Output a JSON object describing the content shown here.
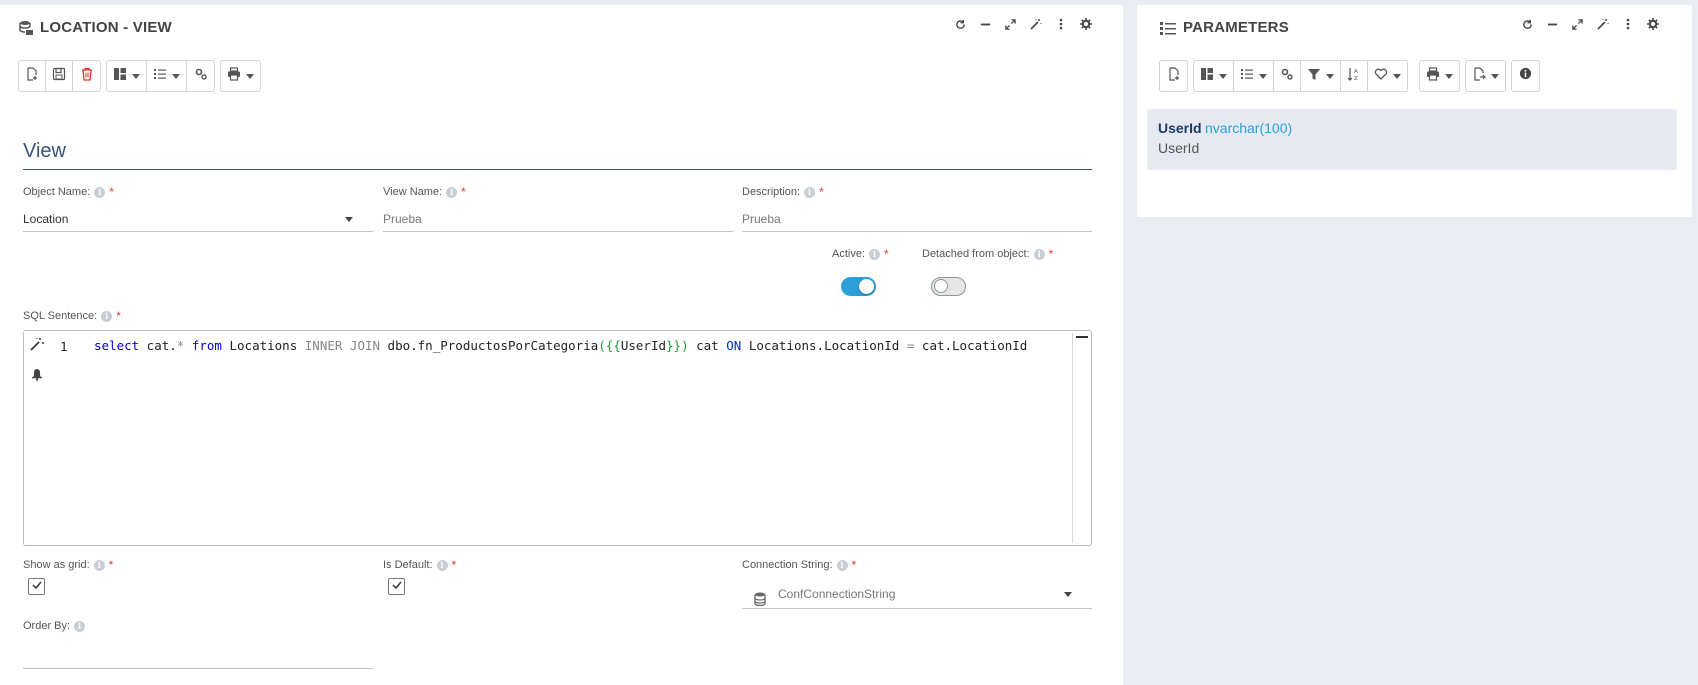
{
  "left_panel": {
    "title": "LOCATION - VIEW",
    "section_title": "View",
    "fields": {
      "object_name": {
        "label": "Object Name:",
        "value": "Location"
      },
      "view_name": {
        "label": "View Name:",
        "value": "Prueba"
      },
      "description": {
        "label": "Description:",
        "value": "Prueba"
      },
      "active": {
        "label": "Active:",
        "on": true
      },
      "detached": {
        "label": "Detached from object:",
        "on": false
      },
      "sql": {
        "label": "SQL Sentence:",
        "line_number": "1",
        "tokens": {
          "select": "select",
          "cat_star": " cat.",
          "star": "*",
          "from": " from",
          "locations": " Locations ",
          "inner_join": "INNER JOIN",
          "fn": " dbo.fn_ProductosPorCategoria",
          "open": "({{",
          "param": "UserId",
          "close": "}})",
          "cat": " cat ",
          "on": "ON",
          "loc_id": " Locations.LocationId ",
          "eq": "=",
          "cat_loc_id": " cat.LocationId"
        }
      },
      "show_as_grid": {
        "label": "Show as grid:",
        "checked": true
      },
      "is_default": {
        "label": "Is Default:",
        "checked": true
      },
      "connection_string": {
        "label": "Connection String:",
        "value": "ConfConnectionString"
      },
      "order_by": {
        "label": "Order By:",
        "value": ""
      }
    }
  },
  "right_panel": {
    "title": "PARAMETERS",
    "parameters": [
      {
        "name": "UserId",
        "type": "nvarchar(100)",
        "description": "UserId"
      }
    ]
  },
  "colors": {
    "accent": "#2c9fd9",
    "heading": "#3a5275",
    "required": "#e53935",
    "delete": "#d9342b",
    "background": "#e9edf3"
  },
  "icons": {
    "left_toolbar": [
      "new-document-icon",
      "save-icon",
      "delete-icon",
      "layout-icon",
      "list-icon",
      "settings-gears-icon",
      "print-icon"
    ],
    "right_toolbar": [
      "new-document-icon",
      "layout-icon",
      "list-icon",
      "settings-gears-icon",
      "filter-icon",
      "sort-az-icon",
      "heart-icon",
      "print-icon",
      "export-icon",
      "info-icon"
    ],
    "window_controls": [
      "refresh-icon",
      "minimize-icon",
      "expand-icon",
      "magic-wand-icon",
      "more-vertical-icon",
      "gear-icon"
    ]
  }
}
